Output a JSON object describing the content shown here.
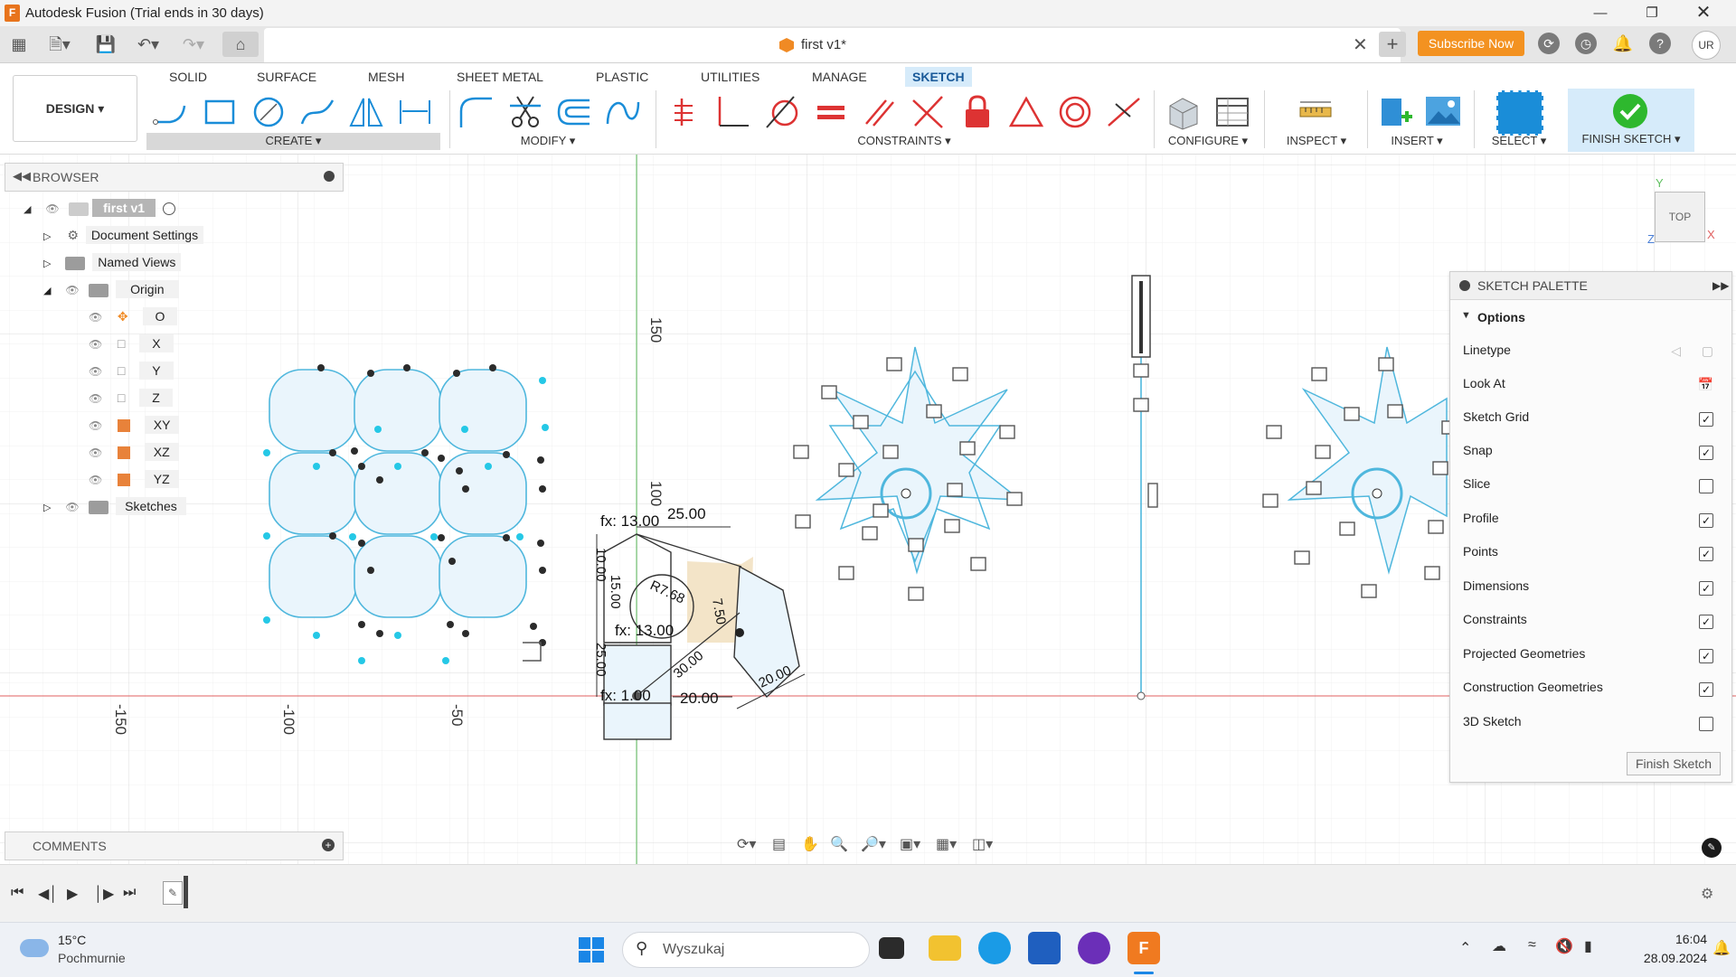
{
  "window": {
    "title": "Autodesk Fusion (Trial ends in 30 days)",
    "app_logo_letter": "F"
  },
  "tabs": {
    "document_title": "first v1*",
    "subscribe_label": "Subscribe Now",
    "user_initials": "UR"
  },
  "ribbon": {
    "workspace_label": "DESIGN ▾",
    "tabs": [
      "SOLID",
      "SURFACE",
      "MESH",
      "SHEET METAL",
      "PLASTIC",
      "UTILITIES",
      "MANAGE",
      "SKETCH"
    ],
    "active_tab": "SKETCH",
    "groups": {
      "create": "CREATE ▾",
      "modify": "MODIFY ▾",
      "constraints": "CONSTRAINTS ▾",
      "configure": "CONFIGURE ▾",
      "inspect": "INSPECT ▾",
      "insert": "INSERT ▾",
      "select": "SELECT ▾",
      "finish": "FINISH SKETCH ▾"
    }
  },
  "browser": {
    "title": "BROWSER",
    "root": "first v1",
    "items": [
      "Document Settings",
      "Named Views",
      "Origin",
      "O",
      "X",
      "Y",
      "Z",
      "XY",
      "XZ",
      "YZ",
      "Sketches"
    ]
  },
  "comments": {
    "title": "COMMENTS"
  },
  "canvas": {
    "ruler_labels": [
      "150",
      "100",
      "-150",
      "-100",
      "-50"
    ],
    "dimensions": [
      "fx: 13.00",
      "25.00",
      "10.00",
      "15.00",
      "fx: 13.00",
      "R7.68",
      "7.50",
      "25.00",
      "30.00",
      "20.00",
      "fx: 1.00",
      "20.00"
    ],
    "viewcube": {
      "face": "TOP",
      "x_axis": "X",
      "y_axis": "Y",
      "z_axis": "Z"
    }
  },
  "palette": {
    "title": "SKETCH PALETTE",
    "section": "Options",
    "rows": [
      {
        "label": "Linetype",
        "type": "icons"
      },
      {
        "label": "Look At",
        "type": "icon"
      },
      {
        "label": "Sketch Grid",
        "checked": true
      },
      {
        "label": "Snap",
        "checked": true
      },
      {
        "label": "Slice",
        "checked": false
      },
      {
        "label": "Profile",
        "checked": true
      },
      {
        "label": "Points",
        "checked": true
      },
      {
        "label": "Dimensions",
        "checked": true
      },
      {
        "label": "Constraints",
        "checked": true
      },
      {
        "label": "Projected Geometries",
        "checked": true
      },
      {
        "label": "Construction Geometries",
        "checked": true
      },
      {
        "label": "3D Sketch",
        "checked": false
      }
    ],
    "finish_label": "Finish Sketch"
  },
  "taskbar": {
    "weather_temp": "15°C",
    "weather_desc": "Pochmurnie",
    "search_placeholder": "Wyszukaj",
    "time": "16:04",
    "date": "28.09.2024"
  },
  "colors": {
    "accent_blue": "#1a8dd8",
    "sketch_cyan": "#4fb7dd",
    "profile_fill": "#eaf5fc",
    "subscribe_orange": "#f39221",
    "finish_green": "#2eb82e"
  }
}
